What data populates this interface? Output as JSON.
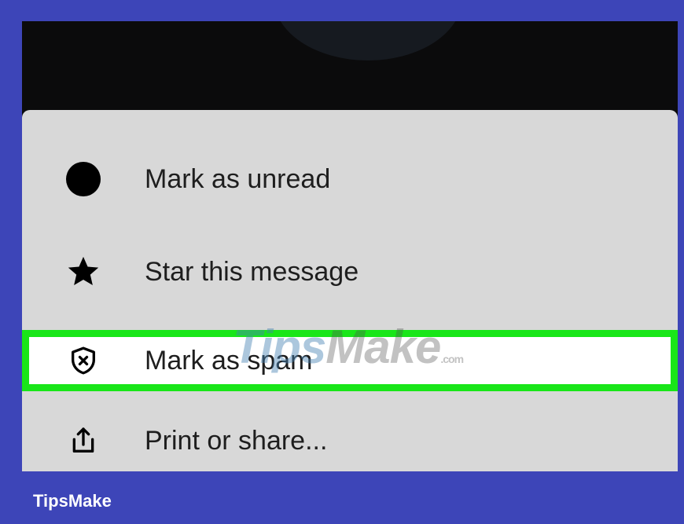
{
  "menu": {
    "items": [
      {
        "label": "Mark as unread",
        "icon": "filled-circle-icon"
      },
      {
        "label": "Star this message",
        "icon": "star-icon"
      },
      {
        "label": "Mark as spam",
        "icon": "shield-x-icon",
        "highlighted": true
      },
      {
        "label": "Print or share...",
        "icon": "share-icon"
      }
    ]
  },
  "watermark": {
    "text_a": "Tips",
    "text_b": "Make",
    "text_c": ".com"
  },
  "brand": "TipsMake",
  "colors": {
    "outer_frame": "#3d45b8",
    "highlight_border": "#19e619",
    "sheet_bg": "#d8d8d8"
  }
}
